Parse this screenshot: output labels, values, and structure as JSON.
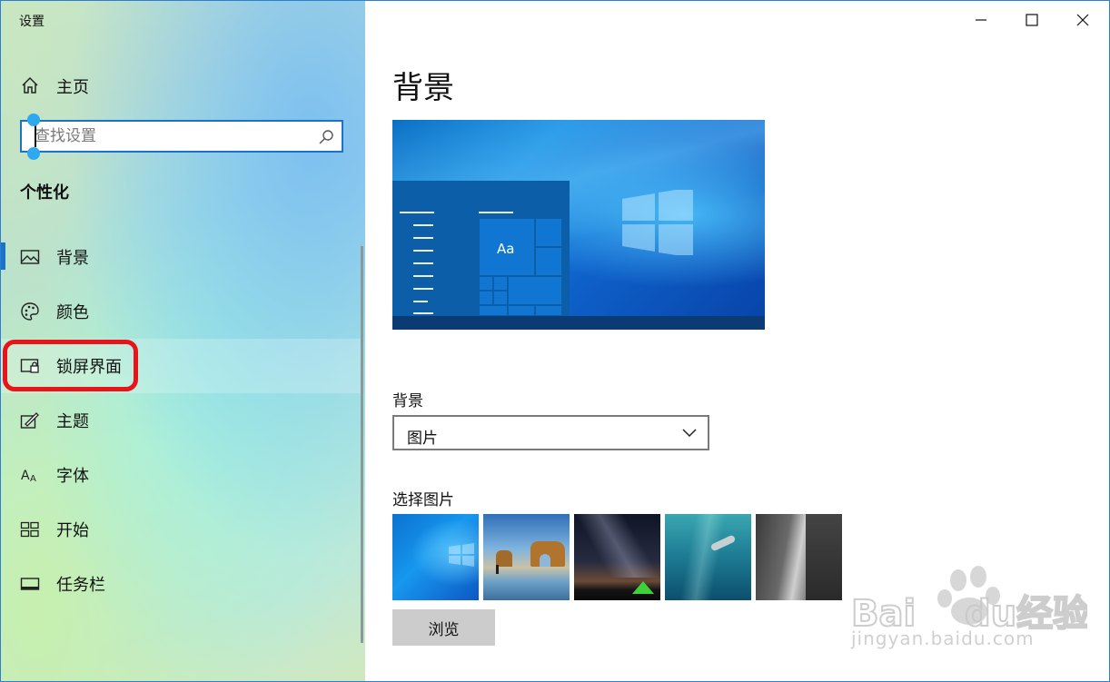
{
  "window": {
    "title": "设置",
    "controls": [
      "minimize-icon",
      "maximize-icon",
      "close-icon"
    ]
  },
  "sidebar": {
    "home_label": "主页",
    "search": {
      "placeholder": "查找设置",
      "value": ""
    },
    "section_title": "个性化",
    "items": [
      {
        "label": "背景",
        "icon": "picture-icon",
        "active": true
      },
      {
        "label": "颜色",
        "icon": "palette-icon"
      },
      {
        "label": "锁屏界面",
        "icon": "lock-screen-icon",
        "highlighted": true
      },
      {
        "label": "主题",
        "icon": "theme-pen-icon"
      },
      {
        "label": "字体",
        "icon": "font-icon"
      },
      {
        "label": "开始",
        "icon": "start-grid-icon"
      },
      {
        "label": "任务栏",
        "icon": "taskbar-icon"
      }
    ],
    "colors": {
      "accent": "#1a73c8",
      "highlight_outline": "#e8141a"
    }
  },
  "main": {
    "title": "背景",
    "preview": {
      "sample_text": "Aa"
    },
    "background_label": "背景",
    "background_value": "图片",
    "choose_picture_label": "选择图片",
    "thumbnails": [
      "windows-blue-wallpaper",
      "beach-rock-arch",
      "night-sky-tent",
      "underwater-swimmer",
      "rock-cliff"
    ],
    "browse_label": "浏览"
  },
  "watermark": {
    "logo_text": "Baidu经验",
    "url": "jingyan.baidu.com"
  }
}
